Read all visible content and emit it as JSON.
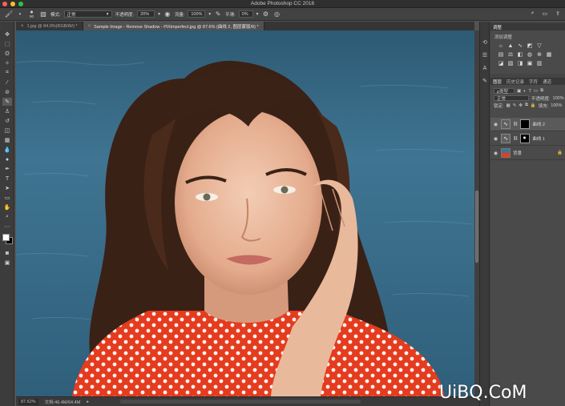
{
  "window": {
    "title": "Adobe Photoshop CC 2018",
    "lights": [
      "#fd5f57",
      "#febc2e",
      "#28c840"
    ]
  },
  "options_bar": {
    "brush_size": "90",
    "mode_label": "模式:",
    "mode_value": "正常",
    "opacity_label": "不透明度:",
    "opacity_value": "20%",
    "flow_label": "流量:",
    "flow_value": "100%",
    "smoothing_label": "平滑:",
    "smoothing_value": "0%"
  },
  "tabs": [
    {
      "label": "1.jpg @ 84.9%(RGB/8#) *",
      "close": "×",
      "active": false
    },
    {
      "label": "Sample Image - Remove Shadow - PiXimperfect.jpg @ 87.6% (曲线 2, 图层蒙版/8) *",
      "close": "×",
      "active": true
    }
  ],
  "status": {
    "zoom": "87.62%",
    "doc": "文档:46.4M/64.4M"
  },
  "panels": {
    "adjustments": {
      "tab": "调整",
      "title": "添加调整"
    },
    "layers": {
      "tabs": [
        "图层",
        "历史记录",
        "字符",
        "通道"
      ],
      "filter_label": "ρ类型",
      "blend_mode": "正常",
      "opacity_label": "不透明度:",
      "opacity_value": "100%",
      "lock_label": "锁定:",
      "fill_label": "填充:",
      "fill_value": "100%",
      "items": [
        {
          "name": "曲线 2",
          "type": "adjustment",
          "selected": true
        },
        {
          "name": "曲线 1",
          "type": "adjustment",
          "selected": false
        },
        {
          "name": "背景",
          "type": "image",
          "selected": false
        }
      ]
    }
  },
  "watermark": "UiBQ.CoM"
}
